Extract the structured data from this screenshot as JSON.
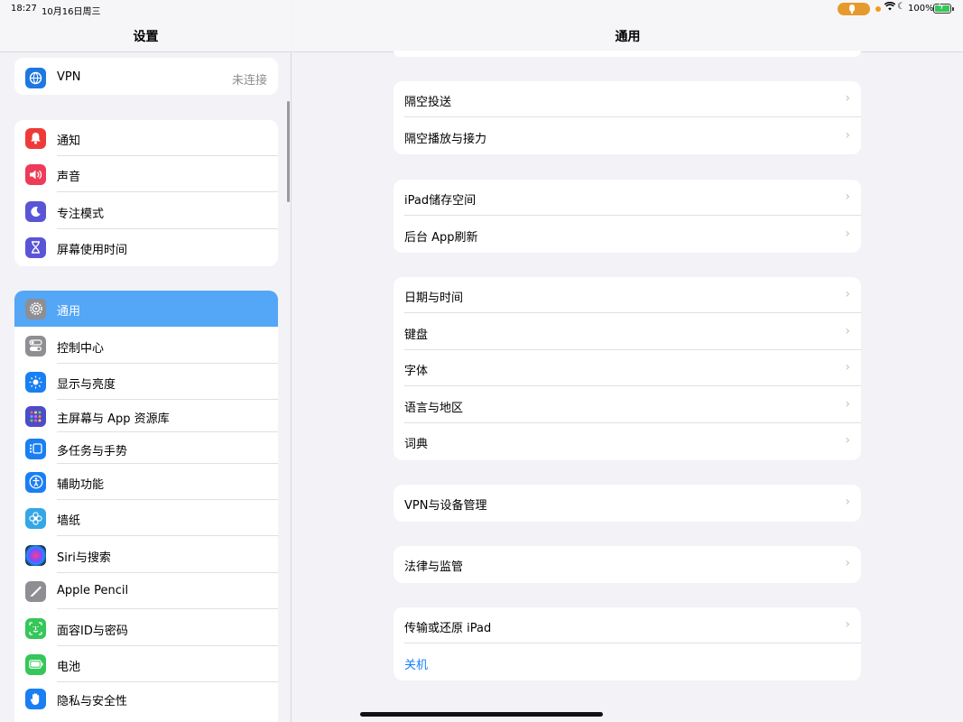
{
  "status_bar": {
    "time": "18:27",
    "date": "10月16日周三",
    "battery_percent": "100%",
    "icons": [
      "mic-icon",
      "wifi-icon",
      "moon-icon",
      "battery-charging-icon"
    ]
  },
  "sidebar": {
    "title": "设置",
    "groups": [
      {
        "items": [
          {
            "label": "VPN",
            "value": "未连接",
            "icon": "vpn-icon",
            "color": "#1e78e0"
          }
        ]
      },
      {
        "items": [
          {
            "label": "通知",
            "icon": "bell-icon",
            "color": "#ee3b39"
          },
          {
            "label": "声音",
            "icon": "speaker-icon",
            "color": "#ee3b57"
          },
          {
            "label": "专注模式",
            "icon": "moon-icon",
            "color": "#5a55d6"
          },
          {
            "label": "屏幕使用时间",
            "icon": "hourglass-icon",
            "color": "#5a55d6"
          }
        ]
      },
      {
        "items": [
          {
            "label": "通用",
            "icon": "gear-icon",
            "color": "#8e8e93",
            "selected": true
          },
          {
            "label": "控制中心",
            "icon": "toggles-icon",
            "color": "#8e8e93"
          },
          {
            "label": "显示与亮度",
            "icon": "sun-icon",
            "color": "#1a7ff2"
          },
          {
            "label": "主屏幕与 App 资源库",
            "icon": "grid-icon",
            "color": "#4d4cc8"
          },
          {
            "label": "多任务与手势",
            "icon": "multitask-icon",
            "color": "#1a7ff2"
          },
          {
            "label": "辅助功能",
            "icon": "accessibility-icon",
            "color": "#1a7ff2"
          },
          {
            "label": "墙纸",
            "icon": "flower-icon",
            "color": "#35a6e6"
          },
          {
            "label": "Siri与搜索",
            "icon": "siri-icon",
            "color": "#222222"
          },
          {
            "label": "Apple Pencil",
            "icon": "pencil-icon",
            "color": "#8e8e93"
          },
          {
            "label": "面容ID与密码",
            "icon": "faceid-icon",
            "color": "#34c759"
          },
          {
            "label": "电池",
            "icon": "battery-icon",
            "color": "#34c759"
          },
          {
            "label": "隐私与安全性",
            "icon": "hand-icon",
            "color": "#1a7ff2"
          }
        ]
      }
    ]
  },
  "detail": {
    "title": "通用",
    "groups": [
      {
        "items": [
          {
            "label": "隔空投送"
          },
          {
            "label": "隔空播放与接力"
          }
        ]
      },
      {
        "items": [
          {
            "label": "iPad储存空间"
          },
          {
            "label": "后台 App刷新"
          }
        ]
      },
      {
        "items": [
          {
            "label": "日期与时间"
          },
          {
            "label": "键盘"
          },
          {
            "label": "字体"
          },
          {
            "label": "语言与地区"
          },
          {
            "label": "词典"
          }
        ]
      },
      {
        "items": [
          {
            "label": "VPN与设备管理"
          }
        ]
      },
      {
        "items": [
          {
            "label": "法律与监管"
          }
        ]
      },
      {
        "items": [
          {
            "label": "传输或还原 iPad"
          },
          {
            "label": "关机",
            "link": true
          }
        ]
      }
    ]
  }
}
